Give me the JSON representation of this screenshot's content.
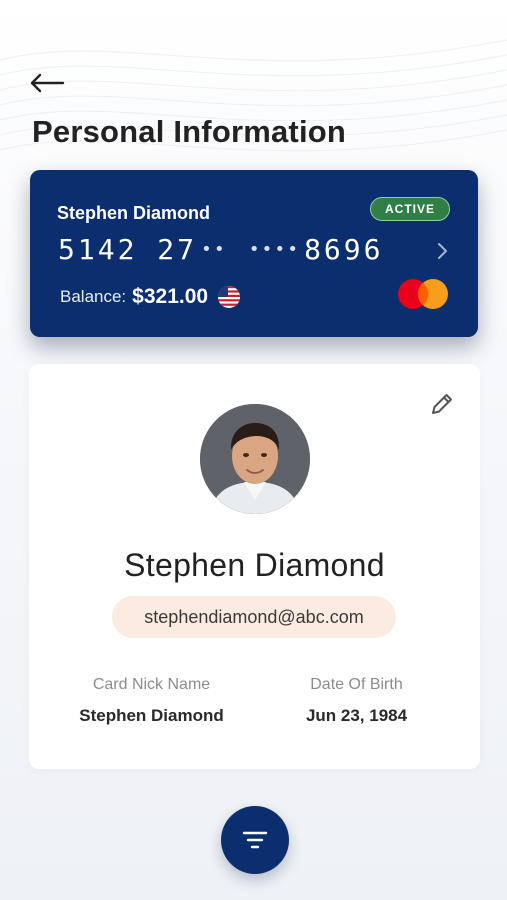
{
  "header": {
    "title": "Personal Information",
    "back_icon": "arrow-left-icon"
  },
  "card": {
    "holder": "Stephen Diamond",
    "status": "ACTIVE",
    "number_prefix": "5142 27",
    "number_masked_1": "••",
    "number_masked_2": "••••",
    "number_suffix": "8696",
    "balance_label": "Balance:",
    "balance_value": "$321.00",
    "currency_flag_icon": "us-flag-icon",
    "network_logo": "mastercard-logo",
    "colors": {
      "background": "#0a2e6e",
      "badge": "#2f7f46"
    }
  },
  "profile": {
    "name": "Stephen Diamond",
    "email": "stephendiamond@abc.com",
    "fields": [
      {
        "label": "Card Nick Name",
        "value": "Stephen Diamond"
      },
      {
        "label": "Date Of Birth",
        "value": "Jun 23, 1984"
      }
    ],
    "edit_icon": "pencil-icon"
  },
  "fab": {
    "icon": "filter-icon"
  }
}
